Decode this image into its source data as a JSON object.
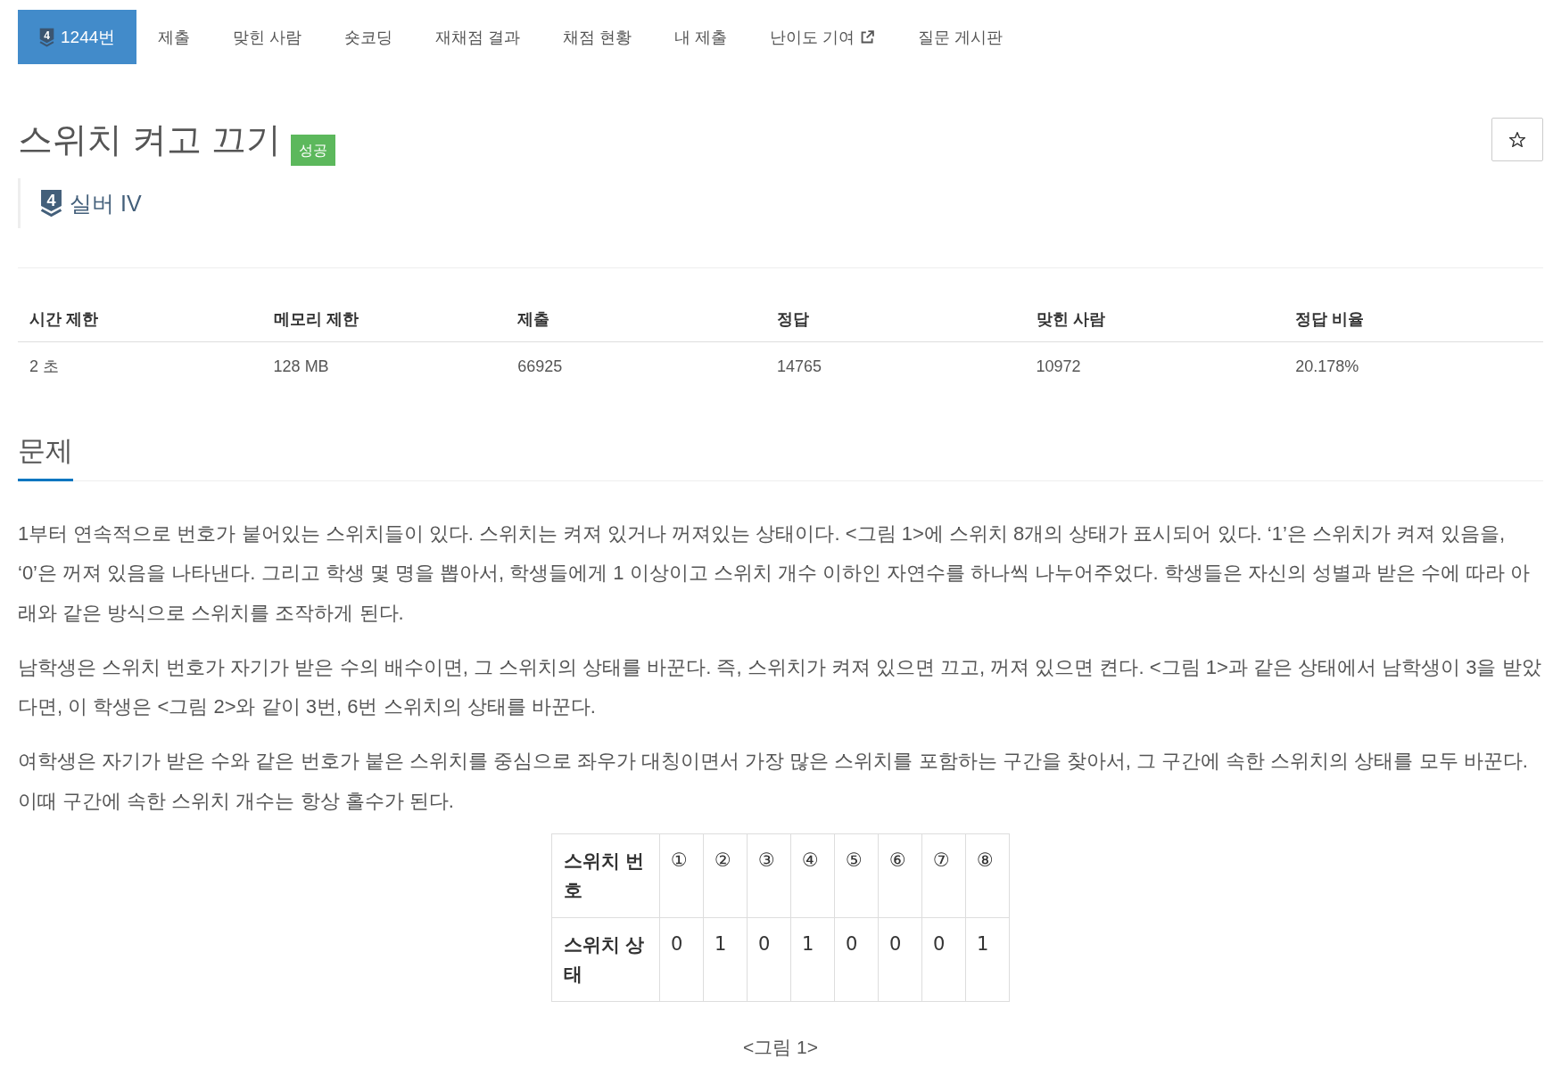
{
  "nav": {
    "tabs": [
      {
        "label": "1244번",
        "tier": "4",
        "selected": true,
        "external": false
      },
      {
        "label": "제출",
        "selected": false,
        "external": false
      },
      {
        "label": "맞힌 사람",
        "selected": false,
        "external": false
      },
      {
        "label": "숏코딩",
        "selected": false,
        "external": false
      },
      {
        "label": "재채점 결과",
        "selected": false,
        "external": false
      },
      {
        "label": "채점 현황",
        "selected": false,
        "external": false
      },
      {
        "label": "내 제출",
        "selected": false,
        "external": false
      },
      {
        "label": "난이도 기여",
        "selected": false,
        "external": true
      },
      {
        "label": "질문 게시판",
        "selected": false,
        "external": false
      }
    ]
  },
  "problem": {
    "title": "스위치 켜고 끄기",
    "result_badge": "성공",
    "starred": false,
    "tier": {
      "number": "4",
      "name": "실버 IV"
    }
  },
  "stats": {
    "columns": [
      "시간 제한",
      "메모리 제한",
      "제출",
      "정답",
      "맞힌 사람",
      "정답 비율"
    ],
    "values": [
      "2 초",
      "128 MB",
      "66925",
      "14765",
      "10972",
      "20.178%"
    ]
  },
  "section": {
    "heading": "문제",
    "paragraphs": [
      "1부터 연속적으로 번호가 붙어있는 스위치들이 있다. 스위치는 켜져 있거나 꺼져있는 상태이다. <그림 1>에 스위치 8개의 상태가 표시되어 있다. ‘1’은 스위치가 켜져 있음을, ‘0’은 꺼져 있음을 나타낸다. 그리고 학생 몇 명을 뽑아서, 학생들에게 1 이상이고 스위치 개수 이하인 자연수를 하나씩 나누어주었다. 학생들은 자신의 성별과 받은 수에 따라 아래와 같은 방식으로 스위치를 조작하게 된다.",
      "남학생은 스위치 번호가 자기가 받은 수의 배수이면, 그 스위치의 상태를 바꾼다. 즉, 스위치가 켜져 있으면 끄고, 꺼져 있으면 켠다. <그림 1>과 같은 상태에서 남학생이 3을 받았다면, 이 학생은 <그림 2>와 같이 3번, 6번 스위치의 상태를 바꾼다.",
      "여학생은 자기가 받은 수와 같은 번호가 붙은 스위치를 중심으로 좌우가 대칭이면서 가장 많은 스위치를 포함하는 구간을 찾아서, 그 구간에 속한 스위치의 상태를 모두 바꾼다. 이때 구간에 속한 스위치 개수는 항상 홀수가 된다."
    ],
    "figure": {
      "rows": [
        {
          "header": "스위치 번호",
          "cells": [
            "①",
            "②",
            "③",
            "④",
            "⑤",
            "⑥",
            "⑦",
            "⑧"
          ]
        },
        {
          "header": "스위치 상태",
          "cells": [
            "0",
            "1",
            "0",
            "1",
            "0",
            "0",
            "0",
            "1"
          ]
        }
      ],
      "caption": "<그림 1>"
    }
  }
}
